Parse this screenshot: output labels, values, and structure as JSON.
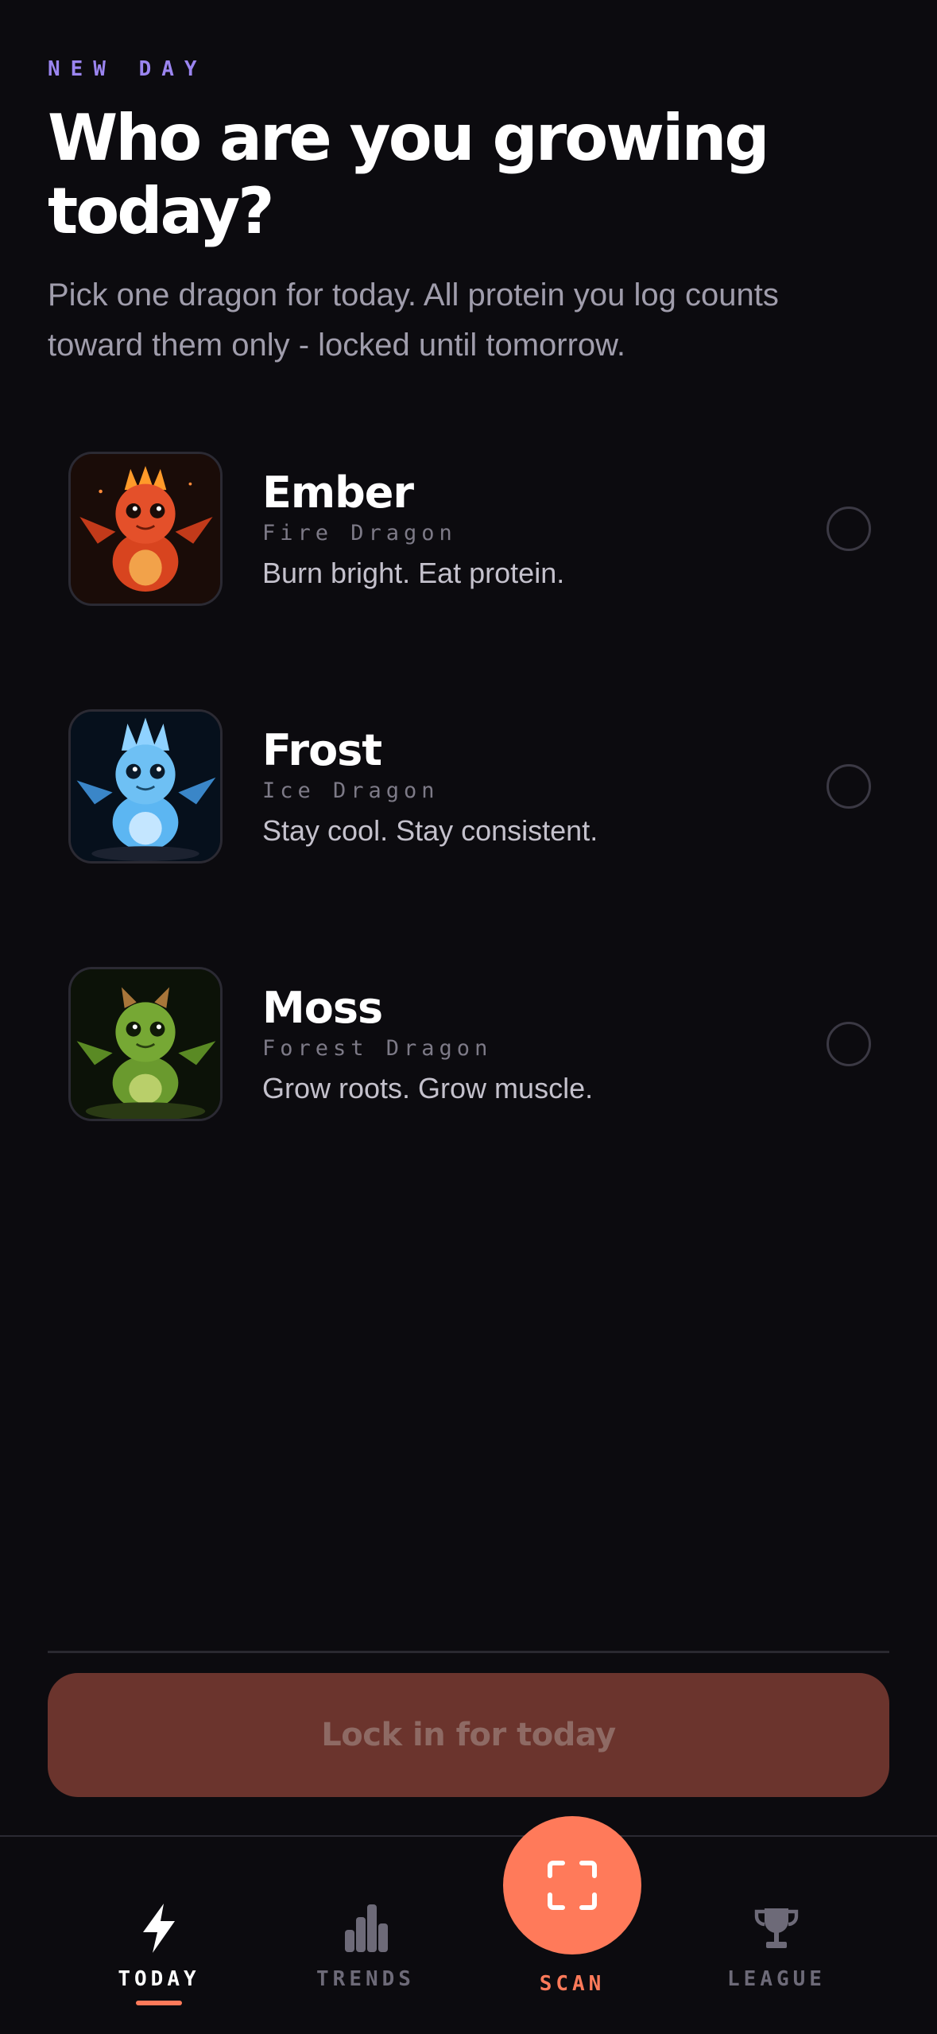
{
  "header": {
    "eyebrow": "NEW DAY",
    "title": "Who are you growing today?",
    "subtitle": "Pick one dragon for today. All protein you log counts toward them only - locked until tomorrow."
  },
  "dragons": [
    {
      "name": "Ember",
      "type": "Fire Dragon",
      "tagline": "Burn bright. Eat protein.",
      "color": "#e4502a",
      "selected": false
    },
    {
      "name": "Frost",
      "type": "Ice Dragon",
      "tagline": "Stay cool. Stay consistent.",
      "color": "#4fb0ef",
      "selected": false
    },
    {
      "name": "Moss",
      "type": "Forest Dragon",
      "tagline": "Grow roots. Grow muscle.",
      "color": "#6a9a2e",
      "selected": false
    }
  ],
  "cta": {
    "label": "Lock in for today",
    "enabled": false
  },
  "tabbar": {
    "today": {
      "label": "TODAY",
      "icon": "bolt-icon",
      "active": true
    },
    "trends": {
      "label": "TRENDS",
      "icon": "bar-chart-icon"
    },
    "scan": {
      "label": "SCAN",
      "icon": "scan-frame-icon"
    },
    "league": {
      "label": "LEAGUE",
      "icon": "trophy-icon"
    }
  },
  "colors": {
    "accent": "#ff7a5a",
    "eyebrow": "#9b85f0",
    "background": "#0c0b0f"
  }
}
